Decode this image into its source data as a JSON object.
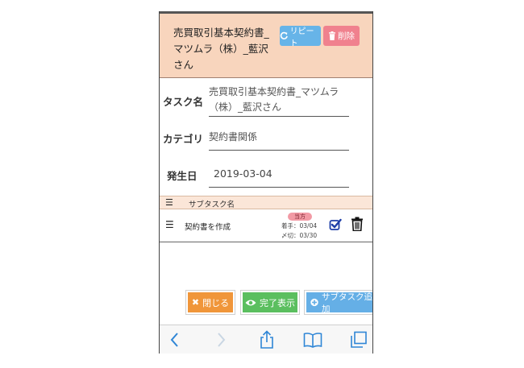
{
  "header": {
    "title": "売買取引基本契約書_マツムラ（株）_藍沢さん",
    "repeat_label": "リピート",
    "delete_label": "削除"
  },
  "form": {
    "task_name_label": "タスク名",
    "task_name_value": "売買取引基本契約書_マツムラ（株）_藍沢さん",
    "category_label": "カテゴリ",
    "category_value": "契約書関係",
    "date_label": "発生日",
    "date_value": "2019-03-04"
  },
  "subtasks": {
    "header_label": "サブタスク名",
    "rows": [
      {
        "name": "契約書を作成",
        "badge": "当方",
        "start": "着手：03/04",
        "deadline": "〆切：03/30"
      }
    ]
  },
  "actions": {
    "close_label": "閉じる",
    "done_label": "完了表示",
    "add_label": "サブタスク追加"
  },
  "colors": {
    "header_bg": "#f8d5bd",
    "repeat": "#67b4e8",
    "delete": "#f0818e",
    "close": "#f0963a",
    "done": "#5bbf5f",
    "add": "#65afe6",
    "toolbar_icon": "#2f86d6"
  },
  "toolbar": {
    "icons": [
      "back-icon",
      "forward-icon",
      "share-icon",
      "bookmarks-icon",
      "tabs-icon"
    ]
  }
}
